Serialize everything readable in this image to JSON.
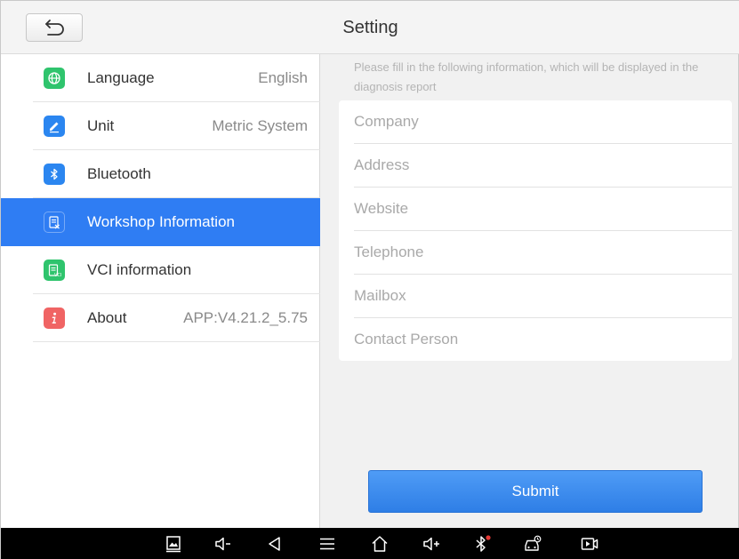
{
  "header": {
    "title": "Setting",
    "back_icon": "back-arrow-icon"
  },
  "sidebar": {
    "items": [
      {
        "label": "Language",
        "value": "English",
        "icon": "globe-icon",
        "color": "#2fc46d",
        "active": false
      },
      {
        "label": "Unit",
        "value": "Metric System",
        "icon": "pencil-icon",
        "color": "#2b86f0",
        "active": false
      },
      {
        "label": "Bluetooth",
        "value": "",
        "icon": "bluetooth-icon",
        "color": "#2b86f0",
        "active": false
      },
      {
        "label": "Workshop Information",
        "value": "",
        "icon": "document-edit-icon",
        "color": "#2f7df3",
        "active": true
      },
      {
        "label": "VCI information",
        "value": "",
        "icon": "vci-document-icon",
        "color": "#2fc46d",
        "active": false
      },
      {
        "label": "About",
        "value": "APP:V4.21.2_5.75",
        "icon": "info-icon",
        "color": "#f06464",
        "active": false
      }
    ]
  },
  "main": {
    "notice": "Please fill in the following information, which will be displayed in the diagnosis report",
    "fields": [
      {
        "placeholder": "Company",
        "value": ""
      },
      {
        "placeholder": "Address",
        "value": ""
      },
      {
        "placeholder": "Website",
        "value": ""
      },
      {
        "placeholder": "Telephone",
        "value": ""
      },
      {
        "placeholder": "Mailbox",
        "value": ""
      },
      {
        "placeholder": "Contact Person",
        "value": ""
      }
    ],
    "submit_label": "Submit"
  },
  "navbar": {
    "icons": [
      "screenshot-icon",
      "volume-down-icon",
      "back-icon",
      "menu-icon",
      "home-icon",
      "volume-up-icon",
      "bluetooth-status-icon",
      "vehicle-diagnosis-icon",
      "screen-record-icon"
    ]
  },
  "colors": {
    "accent": "#2f7df3",
    "navbar": "#000000",
    "panel_bg": "#f1f1f1"
  }
}
